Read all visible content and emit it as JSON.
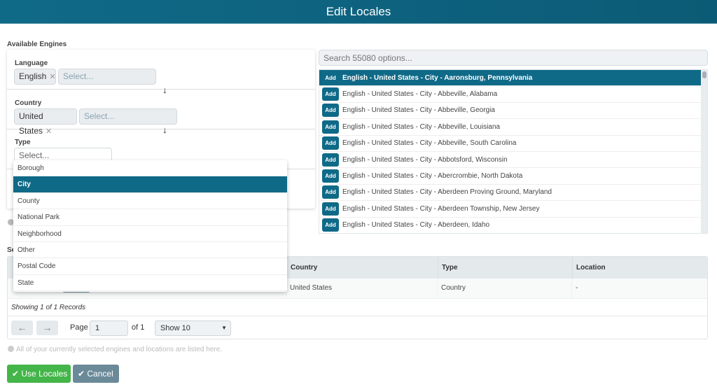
{
  "title": "Edit Locales",
  "available_engines": "Available Engines",
  "language": {
    "label": "Language",
    "tag": "English",
    "placeholder": "Select..."
  },
  "country": {
    "label": "Country",
    "tag": "United States",
    "placeholder": "Select..."
  },
  "type": {
    "label": "Type",
    "placeholder": "Select...",
    "options": [
      "Borough",
      "City",
      "County",
      "National Park",
      "Neighborhood",
      "Other",
      "Postal Code",
      "State"
    ],
    "selected": "City"
  },
  "search_placeholder": "Search 55080 options...",
  "add_label": "Add",
  "options": [
    "English - United States - City - Aaronsburg, Pennsylvania",
    "English - United States - City - Abbeville, Alabama",
    "English - United States - City - Abbeville, Georgia",
    "English - United States - City - Abbeville, Louisiana",
    "English - United States - City - Abbeville, South Carolina",
    "English - United States - City - Abbotsford, Wisconsin",
    "English - United States - City - Abercrombie, North Dakota",
    "English - United States - City - Aberdeen Proving Ground, Maryland",
    "English - United States - City - Aberdeen Township, New Jersey",
    "English - United States - City - Aberdeen, Idaho"
  ],
  "selected_section_label": "Se",
  "table": {
    "headers": [
      "Country",
      "Type",
      "Location"
    ],
    "row": [
      "United States",
      "Country",
      "-"
    ],
    "showing": "Showing 1 of 1 Records"
  },
  "pagination": {
    "page_label": "Page",
    "page": "1",
    "of": "of 1",
    "show": "Show 10"
  },
  "info": "All of your currently selected engines and locations are listed here.",
  "buttons": {
    "use": "Use Locales",
    "cancel": "Cancel"
  },
  "colors": {
    "primary": "#0f6a88",
    "success": "#43b549",
    "secondary": "#6b8a99"
  }
}
